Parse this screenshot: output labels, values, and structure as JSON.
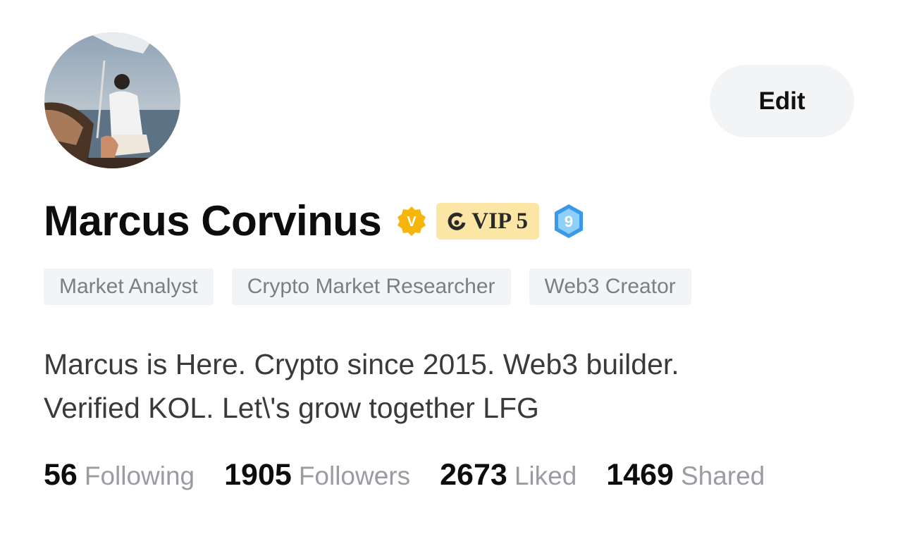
{
  "profile": {
    "name": "Marcus Corvinus",
    "edit_label": "Edit",
    "vip_label": "VIP 5",
    "level": "9",
    "tags": [
      "Market Analyst",
      "Crypto Market Researcher",
      "Web3 Creator"
    ],
    "bio_lines": [
      "Marcus is Here. Crypto since 2015. Web3 builder.",
      "Verified KOL. Let\\'s grow together LFG"
    ],
    "stats": [
      {
        "count": "56",
        "label": "Following"
      },
      {
        "count": "1905",
        "label": "Followers"
      },
      {
        "count": "2673",
        "label": "Liked"
      },
      {
        "count": "1469",
        "label": "Shared"
      }
    ]
  },
  "icons": {
    "avatar": "avatar-photo",
    "verified": "verified-badge-icon",
    "vip": "vip-icon",
    "level": "level-badge-icon"
  },
  "colors": {
    "verified_badge": "#f5b50a",
    "vip_background": "#fce6a6",
    "level_badge": "#3b9ae8",
    "tag_background": "#f3f4f6",
    "edit_button_background": "#f3f4f6"
  }
}
